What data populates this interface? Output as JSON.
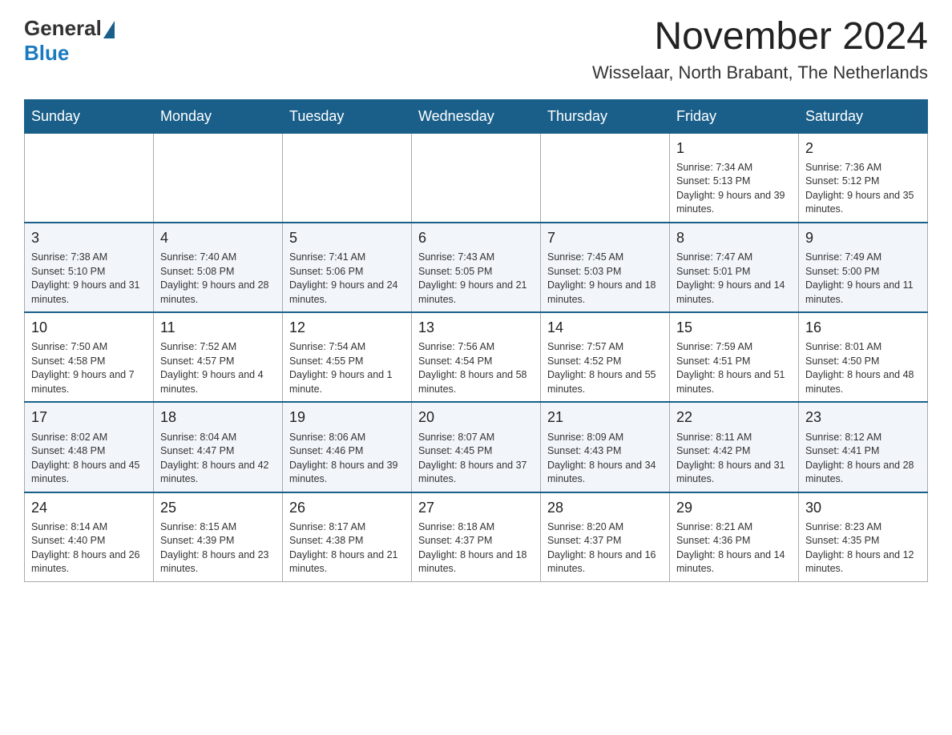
{
  "header": {
    "logo_general": "General",
    "logo_blue": "Blue",
    "month_year": "November 2024",
    "location": "Wisselaar, North Brabant, The Netherlands"
  },
  "calendar": {
    "days_of_week": [
      "Sunday",
      "Monday",
      "Tuesday",
      "Wednesday",
      "Thursday",
      "Friday",
      "Saturday"
    ],
    "weeks": [
      [
        {
          "day": "",
          "info": ""
        },
        {
          "day": "",
          "info": ""
        },
        {
          "day": "",
          "info": ""
        },
        {
          "day": "",
          "info": ""
        },
        {
          "day": "",
          "info": ""
        },
        {
          "day": "1",
          "info": "Sunrise: 7:34 AM\nSunset: 5:13 PM\nDaylight: 9 hours and 39 minutes."
        },
        {
          "day": "2",
          "info": "Sunrise: 7:36 AM\nSunset: 5:12 PM\nDaylight: 9 hours and 35 minutes."
        }
      ],
      [
        {
          "day": "3",
          "info": "Sunrise: 7:38 AM\nSunset: 5:10 PM\nDaylight: 9 hours and 31 minutes."
        },
        {
          "day": "4",
          "info": "Sunrise: 7:40 AM\nSunset: 5:08 PM\nDaylight: 9 hours and 28 minutes."
        },
        {
          "day": "5",
          "info": "Sunrise: 7:41 AM\nSunset: 5:06 PM\nDaylight: 9 hours and 24 minutes."
        },
        {
          "day": "6",
          "info": "Sunrise: 7:43 AM\nSunset: 5:05 PM\nDaylight: 9 hours and 21 minutes."
        },
        {
          "day": "7",
          "info": "Sunrise: 7:45 AM\nSunset: 5:03 PM\nDaylight: 9 hours and 18 minutes."
        },
        {
          "day": "8",
          "info": "Sunrise: 7:47 AM\nSunset: 5:01 PM\nDaylight: 9 hours and 14 minutes."
        },
        {
          "day": "9",
          "info": "Sunrise: 7:49 AM\nSunset: 5:00 PM\nDaylight: 9 hours and 11 minutes."
        }
      ],
      [
        {
          "day": "10",
          "info": "Sunrise: 7:50 AM\nSunset: 4:58 PM\nDaylight: 9 hours and 7 minutes."
        },
        {
          "day": "11",
          "info": "Sunrise: 7:52 AM\nSunset: 4:57 PM\nDaylight: 9 hours and 4 minutes."
        },
        {
          "day": "12",
          "info": "Sunrise: 7:54 AM\nSunset: 4:55 PM\nDaylight: 9 hours and 1 minute."
        },
        {
          "day": "13",
          "info": "Sunrise: 7:56 AM\nSunset: 4:54 PM\nDaylight: 8 hours and 58 minutes."
        },
        {
          "day": "14",
          "info": "Sunrise: 7:57 AM\nSunset: 4:52 PM\nDaylight: 8 hours and 55 minutes."
        },
        {
          "day": "15",
          "info": "Sunrise: 7:59 AM\nSunset: 4:51 PM\nDaylight: 8 hours and 51 minutes."
        },
        {
          "day": "16",
          "info": "Sunrise: 8:01 AM\nSunset: 4:50 PM\nDaylight: 8 hours and 48 minutes."
        }
      ],
      [
        {
          "day": "17",
          "info": "Sunrise: 8:02 AM\nSunset: 4:48 PM\nDaylight: 8 hours and 45 minutes."
        },
        {
          "day": "18",
          "info": "Sunrise: 8:04 AM\nSunset: 4:47 PM\nDaylight: 8 hours and 42 minutes."
        },
        {
          "day": "19",
          "info": "Sunrise: 8:06 AM\nSunset: 4:46 PM\nDaylight: 8 hours and 39 minutes."
        },
        {
          "day": "20",
          "info": "Sunrise: 8:07 AM\nSunset: 4:45 PM\nDaylight: 8 hours and 37 minutes."
        },
        {
          "day": "21",
          "info": "Sunrise: 8:09 AM\nSunset: 4:43 PM\nDaylight: 8 hours and 34 minutes."
        },
        {
          "day": "22",
          "info": "Sunrise: 8:11 AM\nSunset: 4:42 PM\nDaylight: 8 hours and 31 minutes."
        },
        {
          "day": "23",
          "info": "Sunrise: 8:12 AM\nSunset: 4:41 PM\nDaylight: 8 hours and 28 minutes."
        }
      ],
      [
        {
          "day": "24",
          "info": "Sunrise: 8:14 AM\nSunset: 4:40 PM\nDaylight: 8 hours and 26 minutes."
        },
        {
          "day": "25",
          "info": "Sunrise: 8:15 AM\nSunset: 4:39 PM\nDaylight: 8 hours and 23 minutes."
        },
        {
          "day": "26",
          "info": "Sunrise: 8:17 AM\nSunset: 4:38 PM\nDaylight: 8 hours and 21 minutes."
        },
        {
          "day": "27",
          "info": "Sunrise: 8:18 AM\nSunset: 4:37 PM\nDaylight: 8 hours and 18 minutes."
        },
        {
          "day": "28",
          "info": "Sunrise: 8:20 AM\nSunset: 4:37 PM\nDaylight: 8 hours and 16 minutes."
        },
        {
          "day": "29",
          "info": "Sunrise: 8:21 AM\nSunset: 4:36 PM\nDaylight: 8 hours and 14 minutes."
        },
        {
          "day": "30",
          "info": "Sunrise: 8:23 AM\nSunset: 4:35 PM\nDaylight: 8 hours and 12 minutes."
        }
      ]
    ]
  }
}
